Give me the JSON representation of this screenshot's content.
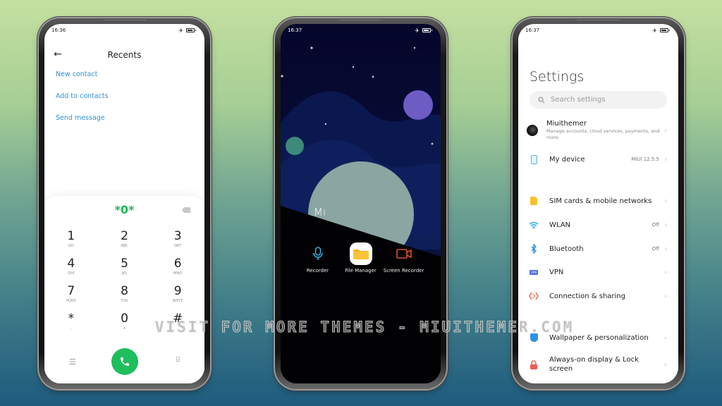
{
  "watermark": "VISIT FOR MORE THEMES - MIUITHEMER.COM",
  "colors": {
    "link_blue": "#2f8fd5",
    "dial_green": "#1ebe5d",
    "moon": "#8aa5a2",
    "planet_purple": "#6d5cc4",
    "planet_teal": "#3b8a7a"
  },
  "phone_dialer": {
    "status_time": "16:36",
    "status_icons": [
      "airplane-mode-icon",
      "battery-icon"
    ],
    "back_icon": "arrow-left-icon",
    "title": "Recents",
    "links": [
      "New contact",
      "Add to contacts",
      "Send message"
    ],
    "display_value": "*0*",
    "keys": [
      {
        "num": "1",
        "letters": "QO"
      },
      {
        "num": "2",
        "letters": "ABC"
      },
      {
        "num": "3",
        "letters": "DEF"
      },
      {
        "num": "4",
        "letters": "GHI"
      },
      {
        "num": "5",
        "letters": "JKL"
      },
      {
        "num": "6",
        "letters": "MNO"
      },
      {
        "num": "7",
        "letters": "PQRS"
      },
      {
        "num": "8",
        "letters": "TUV"
      },
      {
        "num": "9",
        "letters": "WXYZ"
      },
      {
        "num": "*",
        "letters": ","
      },
      {
        "num": "0",
        "letters": "+"
      },
      {
        "num": "#",
        "letters": ""
      }
    ],
    "bottom_icons": [
      "menu-icon",
      "call-icon",
      "keypad-icon"
    ]
  },
  "phone_lockscreen": {
    "status_time": "16:37",
    "status_icons": [
      "airplane-mode-icon",
      "battery-icon"
    ],
    "brand_label": "Mi",
    "quick_apps": [
      {
        "label": "Recorder",
        "icon": "microphone-icon",
        "selected": false
      },
      {
        "label": "File Manager",
        "icon": "folder-icon",
        "selected": true
      },
      {
        "label": "Screen Recorder",
        "icon": "video-camera-icon",
        "selected": false
      }
    ]
  },
  "phone_settings": {
    "status_time": "16:37",
    "status_icons": [
      "airplane-mode-icon",
      "battery-icon"
    ],
    "title": "Settings",
    "search_placeholder": "Search settings",
    "account": {
      "name": "Miuithemer",
      "subtitle": "Manage accounts, cloud services, payments, and more"
    },
    "my_device": {
      "label": "My device",
      "value": "MIUI 12.5.5"
    },
    "items": [
      {
        "label": "SIM cards & mobile networks",
        "value": "",
        "icon": "sim-card-icon"
      },
      {
        "label": "WLAN",
        "value": "Off",
        "icon": "wifi-icon"
      },
      {
        "label": "Bluetooth",
        "value": "Off",
        "icon": "bluetooth-icon"
      },
      {
        "label": "VPN",
        "value": "",
        "icon": "vpn-icon"
      },
      {
        "label": "Connection & sharing",
        "value": "",
        "icon": "connection-sharing-icon"
      }
    ],
    "items2": [
      {
        "label": "Wallpaper & personalization",
        "icon": "wallpaper-icon"
      },
      {
        "label": "Always-on display & Lock screen",
        "icon": "lock-icon"
      }
    ],
    "vpn_badge": "VPN"
  }
}
